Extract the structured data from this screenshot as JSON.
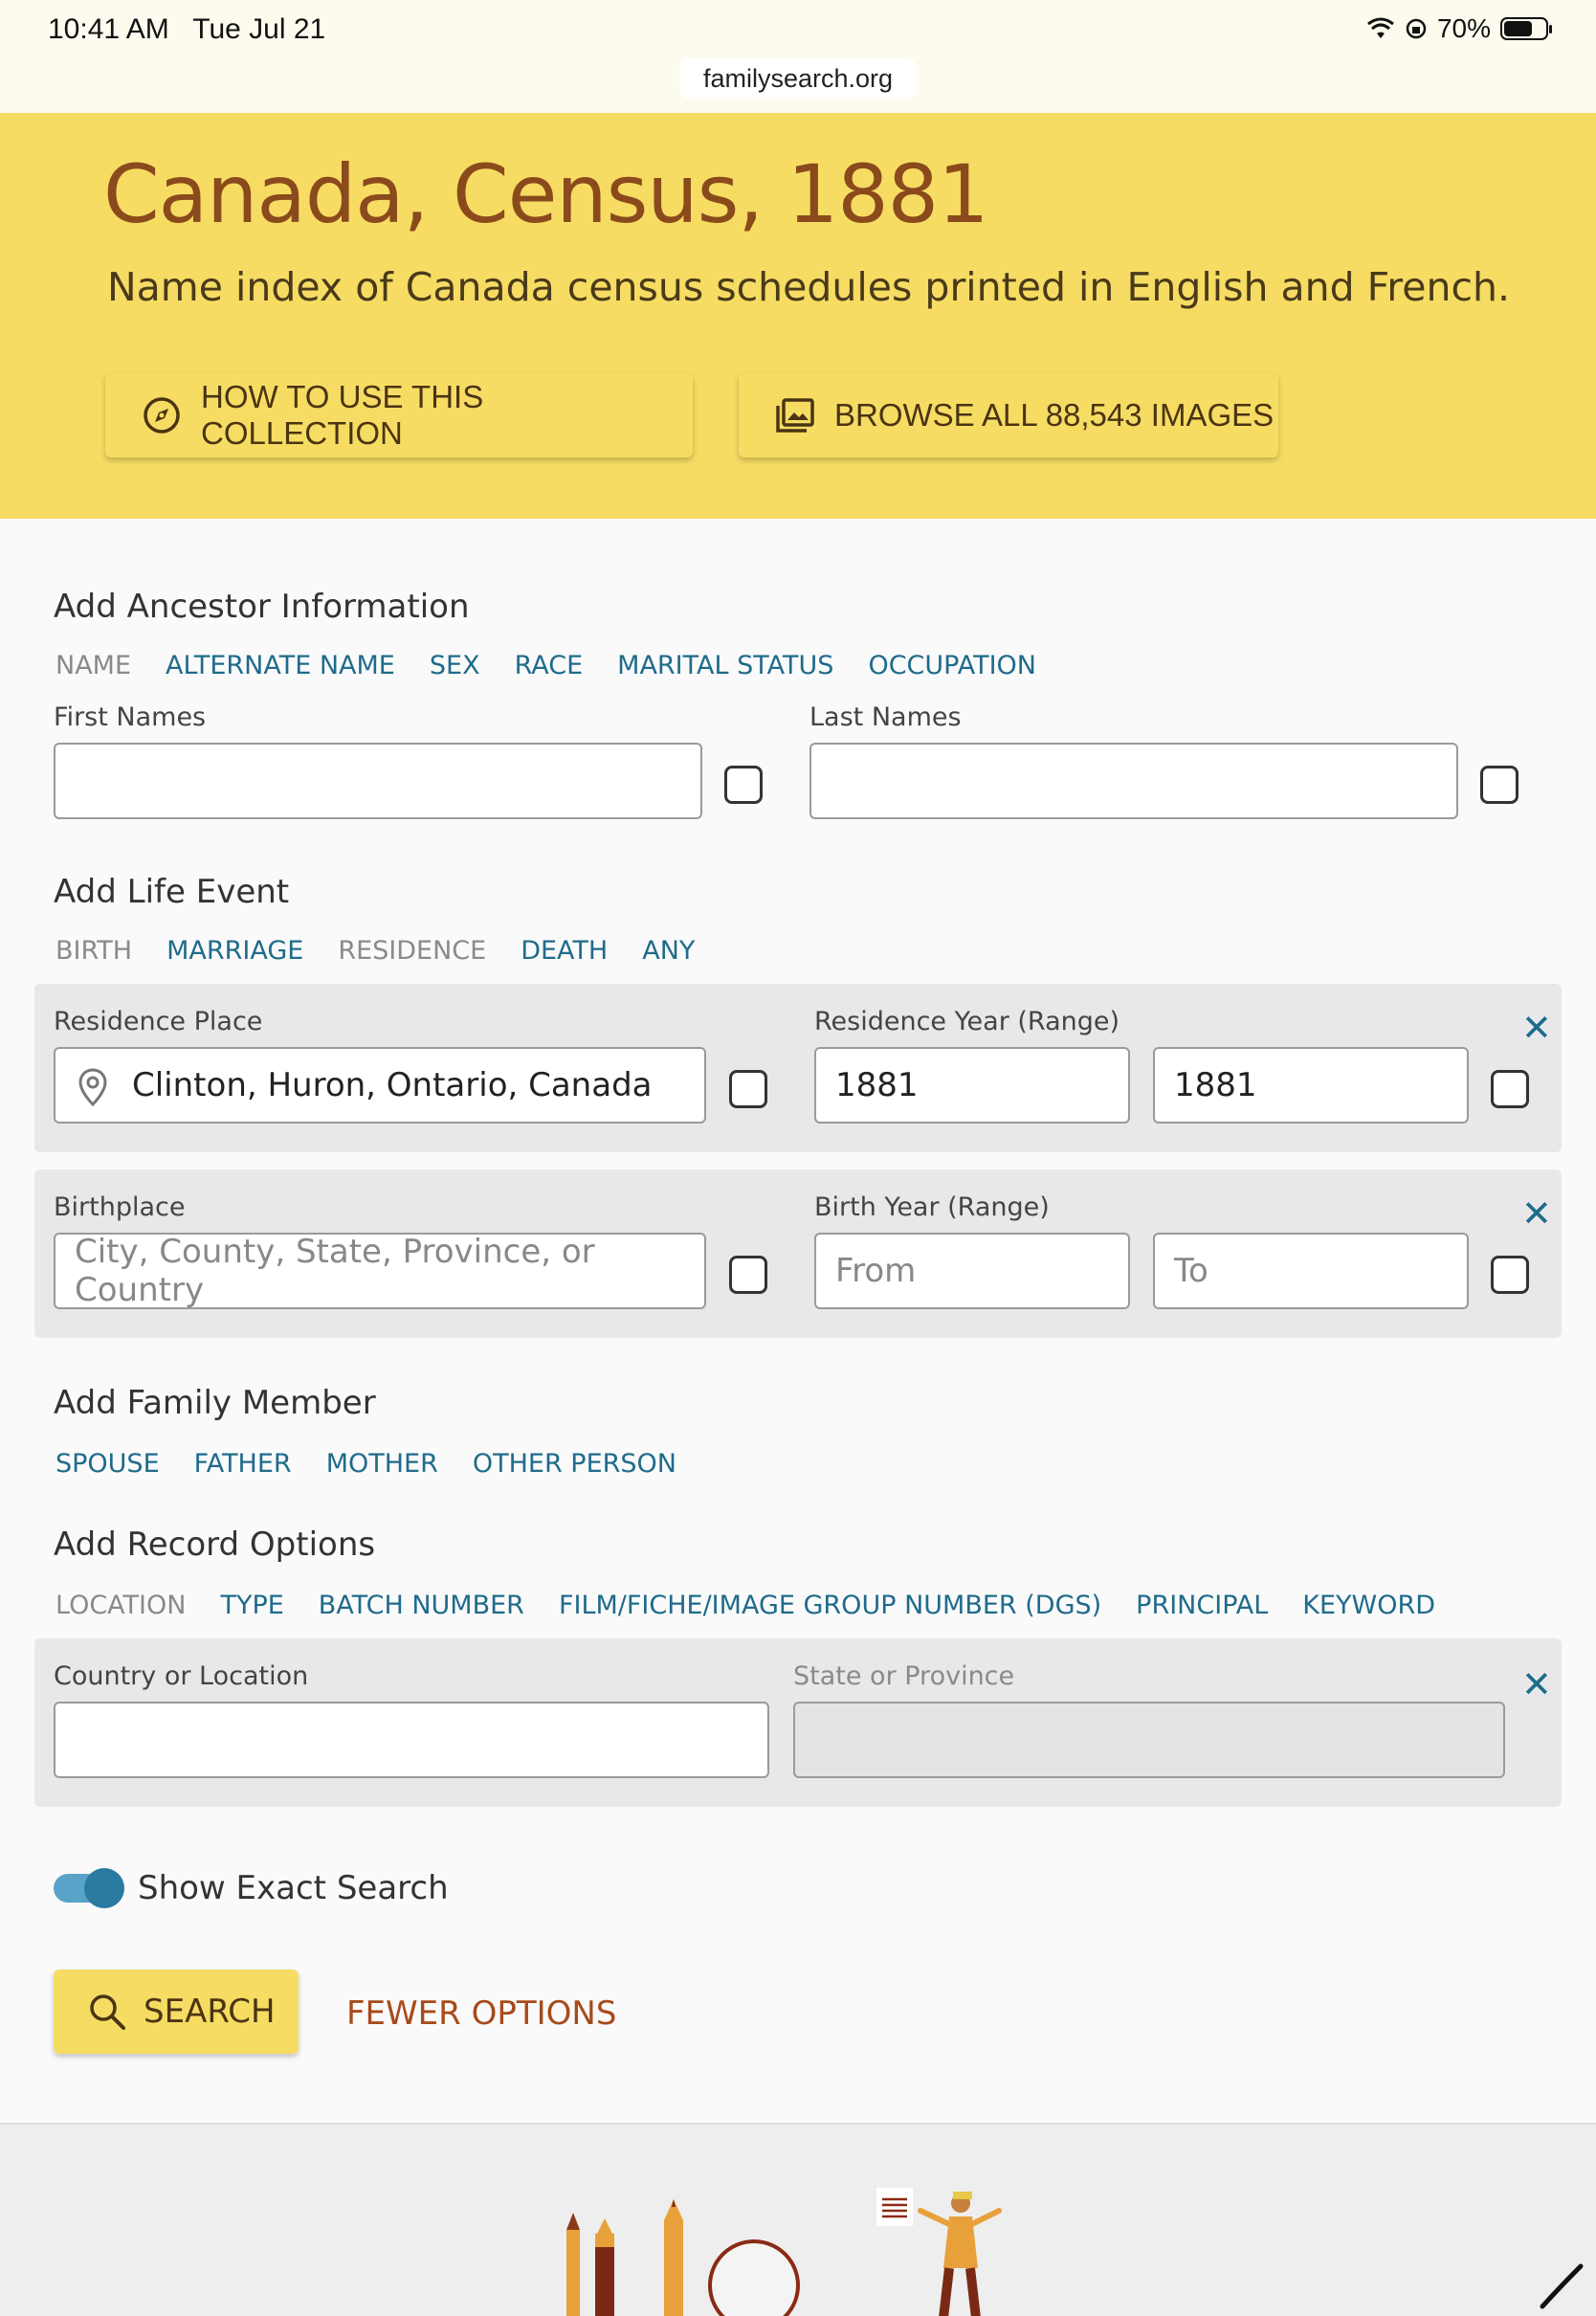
{
  "status_bar": {
    "time": "10:41 AM",
    "date": "Tue Jul 21",
    "battery": "70%",
    "url": "familysearch.org"
  },
  "hero": {
    "title": "Canada, Census, 1881",
    "subtitle": "Name index of Canada census schedules printed in English and French.",
    "how_to_label": "HOW TO USE THIS COLLECTION",
    "browse_label": "BROWSE ALL 88,543 IMAGES"
  },
  "ancestor": {
    "title": "Add Ancestor Information",
    "tabs": [
      "NAME",
      "ALTERNATE NAME",
      "SEX",
      "RACE",
      "MARITAL STATUS",
      "OCCUPATION"
    ],
    "first_names_label": "First Names",
    "last_names_label": "Last Names",
    "first_names_value": "",
    "last_names_value": ""
  },
  "life_event": {
    "title": "Add Life Event",
    "tabs": [
      "BIRTH",
      "MARRIAGE",
      "RESIDENCE",
      "DEATH",
      "ANY"
    ],
    "residence_place_label": "Residence Place",
    "residence_place_value": "Clinton, Huron, Ontario, Canada",
    "residence_year_label": "Residence Year (Range)",
    "residence_year_from": "1881",
    "residence_year_to": "1881",
    "birthplace_label": "Birthplace",
    "birthplace_placeholder": "City, County, State, Province, or Country",
    "birth_year_label": "Birth Year (Range)",
    "birth_year_from_placeholder": "From",
    "birth_year_to_placeholder": "To"
  },
  "family": {
    "title": "Add Family Member",
    "tabs": [
      "SPOUSE",
      "FATHER",
      "MOTHER",
      "OTHER PERSON"
    ]
  },
  "record_options": {
    "title": "Add Record Options",
    "tabs": [
      "LOCATION",
      "TYPE",
      "BATCH NUMBER",
      "FILM/FICHE/IMAGE GROUP NUMBER (DGS)",
      "PRINCIPAL",
      "KEYWORD"
    ],
    "country_label": "Country or Location",
    "state_label": "State or Province"
  },
  "exact_search": {
    "label": "Show Exact Search",
    "enabled": true
  },
  "actions": {
    "search_label": "SEARCH",
    "fewer_options_label": "FEWER OPTIONS"
  },
  "icons": {
    "compass": "compass-icon",
    "images": "images-icon",
    "pin": "location-pin-icon",
    "close": "close-icon",
    "search": "search-icon"
  },
  "colors": {
    "hero_bg": "#f6dc63",
    "title_brown": "#8a4a1c",
    "link_blue": "#1f6b8b",
    "fewer_orange": "#a84a1a"
  }
}
